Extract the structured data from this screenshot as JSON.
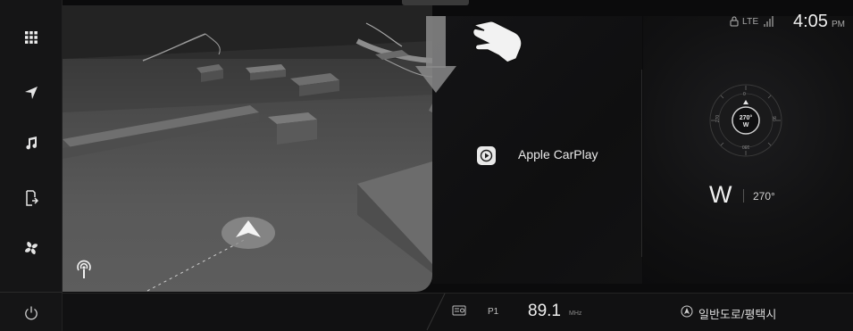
{
  "sidebar": {
    "items": [
      {
        "name": "apps",
        "icon": "apps-grid-icon"
      },
      {
        "name": "navigation",
        "icon": "navigation-arrow-icon"
      },
      {
        "name": "media",
        "icon": "music-note-icon"
      },
      {
        "name": "phone-projection",
        "icon": "phone-projection-icon"
      },
      {
        "name": "climate",
        "icon": "fan-icon"
      }
    ],
    "power_icon": "power-icon"
  },
  "map": {
    "overlay_icon": "radio-signal-icon"
  },
  "carplay": {
    "label": "Apple CarPlay",
    "icon": "carplay-play-icon"
  },
  "compass": {
    "ring_labels": [
      "0",
      "90",
      "180",
      "270"
    ],
    "center_degrees": "270°",
    "center_direction": "W",
    "direction": "W",
    "degrees": "270°"
  },
  "status": {
    "network": "LTE",
    "time": "4:05",
    "ampm": "PM"
  },
  "radio": {
    "preset": "P1",
    "frequency": "89.1",
    "unit": "MHz"
  },
  "road": {
    "name": "일반도로/평택시"
  },
  "colors": {
    "background": "#0b0b0c",
    "text": "#eaeaea",
    "map_ground": "#555555"
  }
}
